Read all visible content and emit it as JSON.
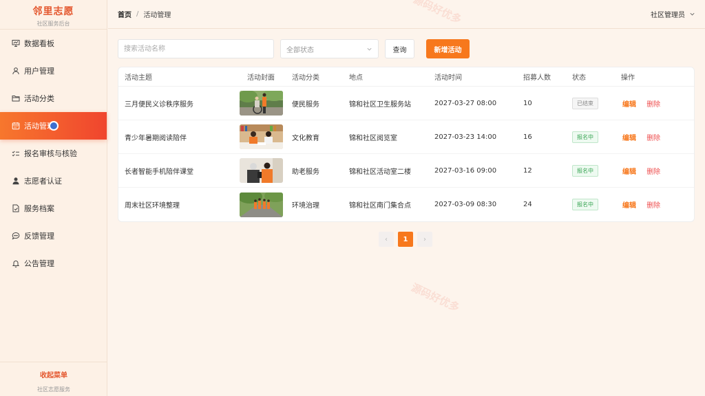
{
  "brand": {
    "title": "邻里志愿",
    "subtitle": "社区服务后台"
  },
  "menu": [
    {
      "label": "数据看板",
      "icon": "presentation-chart-icon",
      "active": false
    },
    {
      "label": "用户管理",
      "icon": "user-icon",
      "active": false
    },
    {
      "label": "活动分类",
      "icon": "folder-icon",
      "active": false
    },
    {
      "label": "活动管理",
      "icon": "calendar-icon",
      "active": true
    },
    {
      "label": "报名审核与核验",
      "icon": "checklist-icon",
      "active": false
    },
    {
      "label": "志愿者认证",
      "icon": "person-solid-icon",
      "active": false
    },
    {
      "label": "服务档案",
      "icon": "file-check-icon",
      "active": false
    },
    {
      "label": "反馈管理",
      "icon": "chat-bubble-icon",
      "active": false
    },
    {
      "label": "公告管理",
      "icon": "bell-icon",
      "active": false
    }
  ],
  "sidebar_footer": {
    "collapse_label": "收起菜单",
    "sub": "社区志愿服务"
  },
  "header": {
    "breadcrumb_home": "首页",
    "breadcrumb_sep": "/",
    "breadcrumb_current": "活动管理",
    "user_label": "社区管理员"
  },
  "toolbar": {
    "search_placeholder": "搜索活动名称",
    "status_select": "全部状态",
    "query_label": "查询",
    "add_label": "新增活动"
  },
  "table": {
    "columns": [
      "活动主题",
      "活动封面",
      "活动分类",
      "地点",
      "活动时间",
      "招募人数",
      "状态",
      "操作"
    ],
    "rows": [
      {
        "title": "三月便民义诊秩序服务",
        "category": "便民服务",
        "location": "锦和社区卫生服务站",
        "time": "2027-03-27 08:00",
        "count": "10",
        "status": "已结束",
        "status_type": "ended",
        "cover": "wheelchair-park-photo"
      },
      {
        "title": "青少年暑期阅读陪伴",
        "category": "文化教育",
        "location": "锦和社区阅览室",
        "time": "2027-03-23 14:00",
        "count": "16",
        "status": "报名中",
        "status_type": "open",
        "cover": "library-reading-photo"
      },
      {
        "title": "长者智能手机陪伴课堂",
        "category": "助老服务",
        "location": "锦和社区活动室二楼",
        "time": "2027-03-16 09:00",
        "count": "12",
        "status": "报名中",
        "status_type": "open",
        "cover": "elder-phone-photo"
      },
      {
        "title": "周末社区环境整理",
        "category": "环境治理",
        "location": "锦和社区南门集合点",
        "time": "2027-03-09 08:30",
        "count": "24",
        "status": "报名中",
        "status_type": "open",
        "cover": "street-cleanup-photo"
      }
    ],
    "edit_label": "编辑",
    "delete_label": "删除"
  },
  "pagination": {
    "prev": "‹",
    "current": "1",
    "next": "›"
  },
  "watermark": "源码好优多",
  "colors": {
    "accent": "#f7781d",
    "active_gradient_start": "#f7772d",
    "active_gradient_end": "#f0452e",
    "brand": "#e4572e",
    "danger": "#ee4f4f",
    "success": "#3aa655"
  }
}
